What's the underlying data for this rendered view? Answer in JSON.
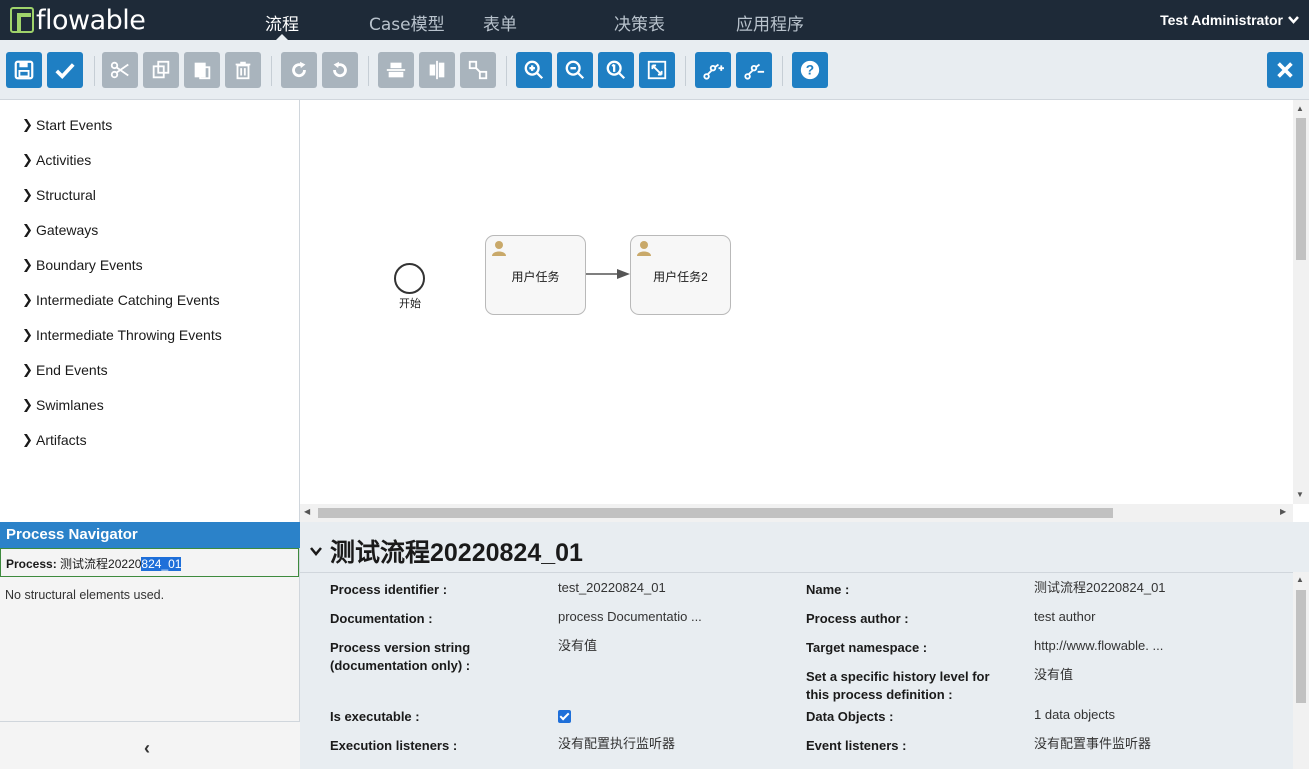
{
  "app": {
    "logo_text": "flowable",
    "nav": [
      "流程",
      "Case模型",
      "表单",
      "决策表",
      "应用程序"
    ],
    "user": "Test Administrator"
  },
  "toolbar": {
    "icons": [
      "save-icon",
      "check-icon",
      "cut-icon",
      "copy-icon",
      "paste-icon",
      "delete-icon",
      "redo-icon",
      "undo-icon",
      "align-horizontal-icon",
      "align-vertical-icon",
      "same-size-icon",
      "zoom-in-icon",
      "zoom-out-icon",
      "zoom-actual-icon",
      "zoom-fit-icon",
      "add-bendpoint-icon",
      "remove-bendpoint-icon",
      "help-icon",
      "close-icon"
    ]
  },
  "palette": {
    "items": [
      "Start Events",
      "Activities",
      "Structural",
      "Gateways",
      "Boundary Events",
      "Intermediate Catching Events",
      "Intermediate Throwing Events",
      "End Events",
      "Swimlanes",
      "Artifacts"
    ]
  },
  "canvas": {
    "start_label": "开始",
    "task1": "用户任务",
    "task2": "用户任务2"
  },
  "navigator": {
    "title": "Process Navigator",
    "process_prefix": "Process:",
    "process_name_a": "测试流程20220",
    "process_name_b": "824_01",
    "empty": "No structural elements used."
  },
  "props": {
    "title": "测试流程20220824_01",
    "left": [
      {
        "label": "Process identifier :",
        "value": "test_20220824_01"
      },
      {
        "label": "Documentation :",
        "value": "process Documentatio ..."
      },
      {
        "label": "Process version string (documentation only) :",
        "value": "没有值"
      },
      {
        "label": "Is executable :",
        "value": ""
      },
      {
        "label": "Execution listeners :",
        "value": "没有配置执行监听器"
      }
    ],
    "right": [
      {
        "label": "Name :",
        "value": "测试流程20220824_01"
      },
      {
        "label": "Process author :",
        "value": "test author"
      },
      {
        "label": "Target namespace :",
        "value": "http://www.flowable. ..."
      },
      {
        "label": "Set a specific history level for this process definition :",
        "value": "没有值"
      },
      {
        "label": "Data Objects :",
        "value": "1 data objects"
      },
      {
        "label": "Event listeners :",
        "value": "没有配置事件监听器"
      }
    ]
  },
  "colors": {
    "nav_bg": "#1e2a38",
    "accent": "#1f7fc3",
    "toolbar_bg": "#e8edf1"
  }
}
